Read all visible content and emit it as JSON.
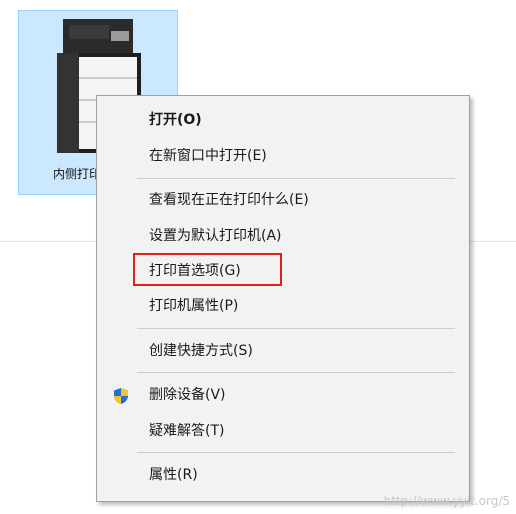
{
  "desktop": {
    "printer_label": "内侧打印机"
  },
  "context_menu": {
    "items": [
      {
        "label": "打开(O)",
        "bold": true
      },
      {
        "label": "在新窗口中打开(E)"
      },
      {
        "label": "查看现在正在打印什么(E)"
      },
      {
        "label": "设置为默认打印机(A)"
      },
      {
        "label": "打印首选项(G)",
        "highlighted": true
      },
      {
        "label": "打印机属性(P)"
      },
      {
        "label": "创建快捷方式(S)"
      },
      {
        "label": "删除设备(V)",
        "icon": "uac-shield-icon"
      },
      {
        "label": "疑难解答(T)"
      },
      {
        "label": "属性(R)"
      }
    ]
  },
  "colors": {
    "selection_bg": "#cce8ff",
    "menu_bg": "#f2f2f2",
    "highlight_border": "#e0201b"
  },
  "watermark": "http://www.yyit.org/5"
}
